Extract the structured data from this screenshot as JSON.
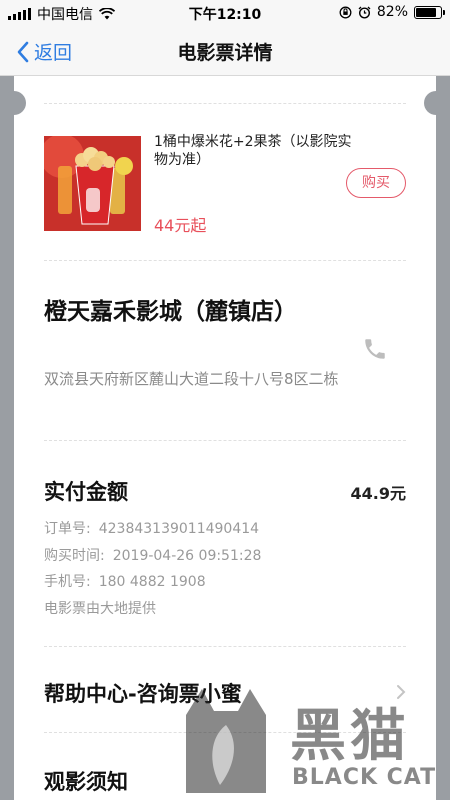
{
  "status_bar": {
    "carrier": "中国电信",
    "time": "下午12:10",
    "battery": "82%",
    "battery_level": 0.82
  },
  "nav": {
    "back_label": "返回",
    "title": "电影票详情"
  },
  "combo": {
    "name": "1桶中爆米花+2果茶（以影院实物为准）",
    "buy_label": "购买",
    "price": "44元起"
  },
  "cinema": {
    "name": "橙天嘉禾影城（麓镇店）",
    "address": "双流县天府新区麓山大道二段十八号8区二栋"
  },
  "payment": {
    "paid_label": "实付金额",
    "paid_amount": "44.9元",
    "order_label": "订单号:",
    "order_no": "423843139011490414",
    "buy_time_label": "购买时间:",
    "buy_time": "2019-04-26 09:51:28",
    "phone_label": "手机号:",
    "phone": "180 4882 1908",
    "provider": "电影票由大地提供"
  },
  "help": {
    "label": "帮助中心-咨询票小蜜"
  },
  "notice": {
    "label": "观影须知"
  },
  "watermark": {
    "cn": "黑猫",
    "en": "BLACK CAT"
  },
  "colors": {
    "accent_blue": "#2f7de1",
    "price_red": "#e8505b",
    "background_gray": "#9a9ea3"
  }
}
